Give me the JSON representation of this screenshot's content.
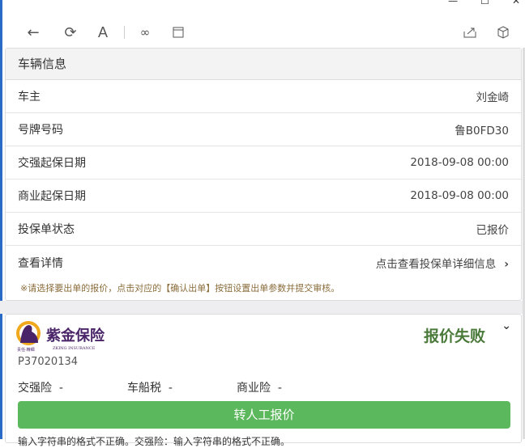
{
  "toolbar": {
    "icons": [
      "back-icon",
      "refresh-icon",
      "font-icon",
      "link-icon",
      "window-icon",
      "share-icon",
      "cube-icon"
    ]
  },
  "vehicle": {
    "title": "车辆信息",
    "rows": [
      {
        "label": "车主",
        "value": "刘金崎"
      },
      {
        "label": "号牌号码",
        "value": "鲁B0FD30"
      },
      {
        "label": "交强起保日期",
        "value": "2018-09-08 00:00"
      },
      {
        "label": "商业起保日期",
        "value": "2018-09-08 00:00"
      },
      {
        "label": "投保单状态",
        "value": "已报价"
      },
      {
        "label": "查看详情",
        "value": "点击查看投保单详细信息"
      }
    ],
    "note": "※请选择要出单的报价，点击对应的【确认出单】按钮设置出单参数并提交审核。"
  },
  "quote": {
    "company": "紫金保险",
    "company_en": "ZKING INSURANCE",
    "slogan": "责任·精细",
    "id": "P37020134",
    "status": "报价失败",
    "status_color": "#4a7a3a",
    "prices": [
      {
        "label": "交强险",
        "value": "-"
      },
      {
        "label": "车船税",
        "value": "-"
      },
      {
        "label": "商业险",
        "value": "-"
      }
    ],
    "button": "转人工报价",
    "error": "输入字符串的格式不正确。交强险：输入字符串的格式不正确。"
  }
}
